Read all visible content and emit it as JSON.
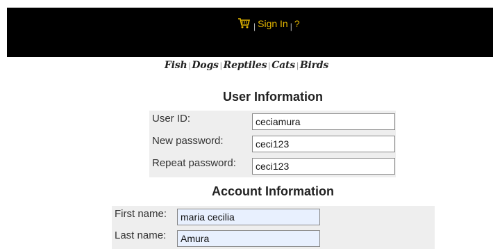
{
  "header": {
    "cart_icon": "shopping-cart-icon",
    "separator": "|",
    "sign_in_label": "Sign In",
    "help_label": "?",
    "accent_color": "#e6b800"
  },
  "categories": [
    "Fish",
    "Dogs",
    "Reptiles",
    "Cats",
    "Birds"
  ],
  "user_info": {
    "title": "User Information",
    "user_id": {
      "label": "User ID:",
      "value": "ceciamura"
    },
    "new_password": {
      "label": "New password:",
      "value": "ceci123"
    },
    "repeat_password": {
      "label": "Repeat password:",
      "value": "ceci123"
    }
  },
  "account_info": {
    "title": "Account Information",
    "first_name": {
      "label": "First name:",
      "value": "maria cecilia"
    },
    "last_name": {
      "label": "Last name:",
      "value": "Amura"
    }
  }
}
